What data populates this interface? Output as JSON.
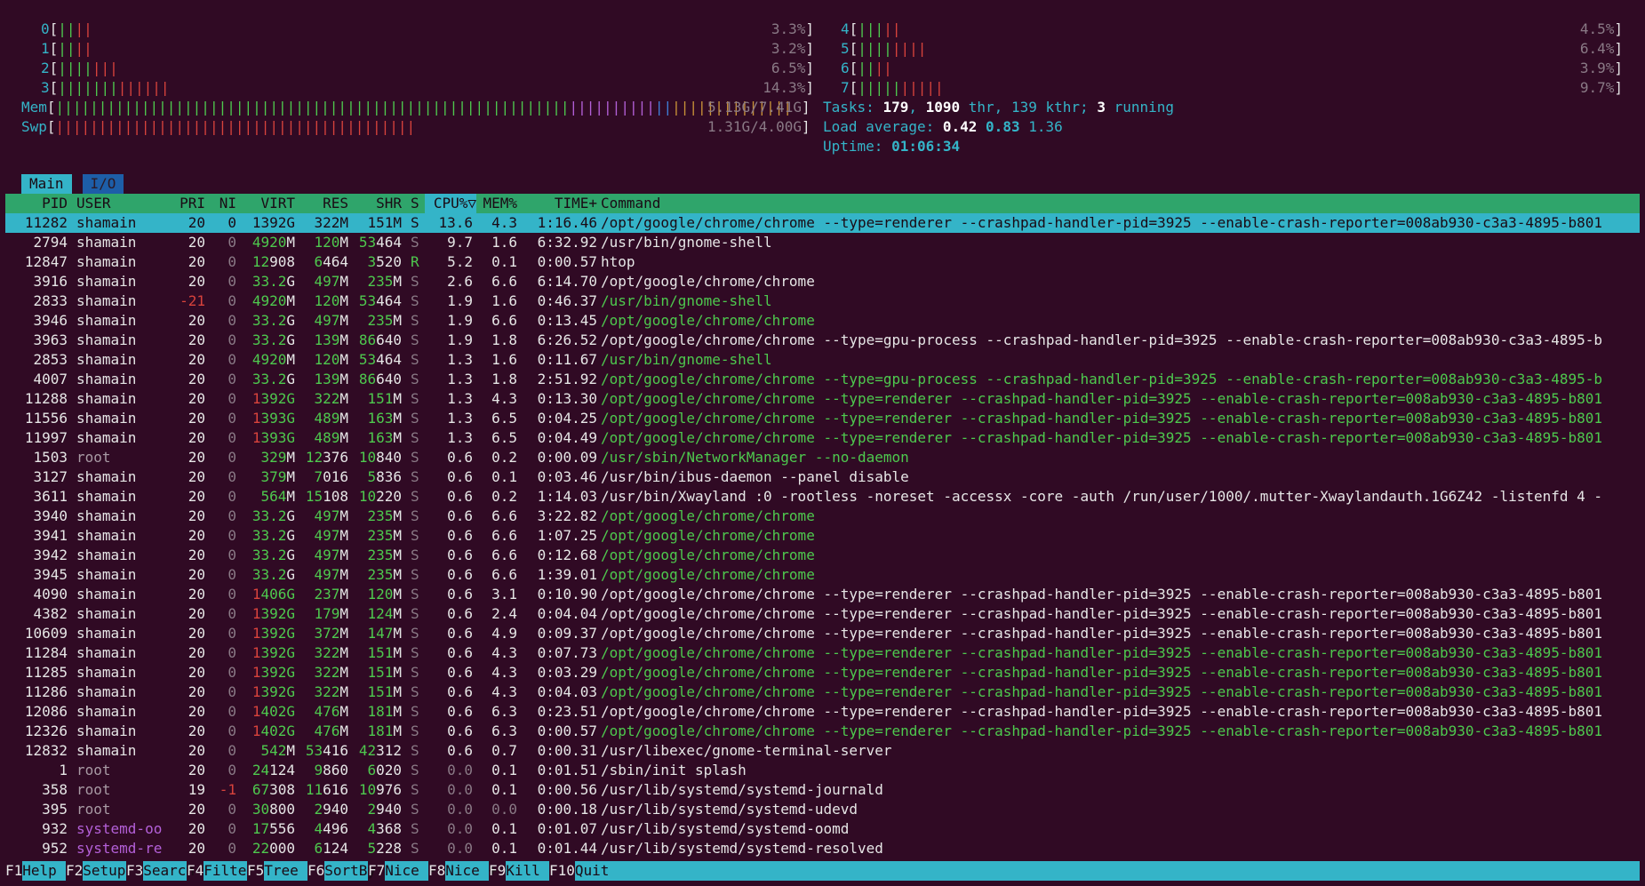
{
  "colors": {
    "background": "#300a24",
    "label": "#34b4c8",
    "green": "#4ec94e",
    "red": "#d8433c",
    "header_bg": "#2fa56b",
    "selection": "#34b4c8"
  },
  "cpus": [
    {
      "id": "0",
      "bars": "||||",
      "pct": "3.3%"
    },
    {
      "id": "1",
      "bars": "||||",
      "pct": "3.2%"
    },
    {
      "id": "2",
      "bars": "|||||||",
      "pct": "6.5%"
    },
    {
      "id": "3",
      "bars": "|||||||||||||",
      "pct": "14.3%"
    },
    {
      "id": "4",
      "bars": "|||||",
      "pct": "4.5%"
    },
    {
      "id": "5",
      "bars": "||||||||",
      "pct": "6.4%"
    },
    {
      "id": "6",
      "bars": "||||",
      "pct": "3.9%"
    },
    {
      "id": "7",
      "bars": "||||||||||",
      "pct": "9.7%"
    }
  ],
  "mem": {
    "label": "Mem",
    "used_bars": "||||||||||||||||||||||||||||||||||||||||||||||||||||||||||||",
    "buf_bars": "||||||||||",
    "cache_bars": "||||||||||||||",
    "value": "5.13G/7.41G"
  },
  "swp": {
    "label": "Swp",
    "bars": "||||||||||||||||||||||||||||||||||||||||||",
    "value": "1.31G/4.00G"
  },
  "tasks": {
    "label": "Tasks:",
    "tasks": "179",
    "thr": "1090",
    "thr_label": "thr,",
    "kthr": "139",
    "kthr_label": "kthr;",
    "running": "3",
    "running_label": "running"
  },
  "load": {
    "label": "Load average:",
    "l1": "0.42",
    "l5": "0.83",
    "l15": "1.36"
  },
  "uptime": {
    "label": "Uptime:",
    "value": "01:06:34"
  },
  "tabs": [
    "Main",
    "I/O"
  ],
  "columns": {
    "pid": "PID",
    "user": "USER",
    "pri": "PRI",
    "ni": "NI",
    "virt": "VIRT",
    "res": "RES",
    "shr": "SHR",
    "s": "S",
    "cpu": "CPU%▽",
    "mem": "MEM%",
    "time": "TIME+",
    "cmd": "Command"
  },
  "processes": [
    [
      "11282",
      "shamain",
      "20",
      "0",
      "1392G",
      "322M",
      "151M",
      "S",
      "13.6",
      "4.3",
      "1:16.46",
      "/opt/google/chrome/chrome --type=renderer --crashpad-handler-pid=3925 --enable-crash-reporter=008ab930-c3a3-4895-b801"
    ],
    [
      "2794",
      "shamain",
      "20",
      "0",
      "4920M",
      "120M",
      "53464",
      "S",
      "9.7",
      "1.6",
      "6:32.92",
      "/usr/bin/gnome-shell"
    ],
    [
      "12847",
      "shamain",
      "20",
      "0",
      "12908",
      "6464",
      "3520",
      "R",
      "5.2",
      "0.1",
      "0:00.57",
      "htop"
    ],
    [
      "3916",
      "shamain",
      "20",
      "0",
      "33.2G",
      "497M",
      "235M",
      "S",
      "2.6",
      "6.6",
      "6:14.70",
      "/opt/google/chrome/chrome"
    ],
    [
      "2833",
      "shamain",
      "-21",
      "0",
      "4920M",
      "120M",
      "53464",
      "S",
      "1.9",
      "1.6",
      "0:46.37",
      "/usr/bin/gnome-shell"
    ],
    [
      "3946",
      "shamain",
      "20",
      "0",
      "33.2G",
      "497M",
      "235M",
      "S",
      "1.9",
      "6.6",
      "0:13.45",
      "/opt/google/chrome/chrome"
    ],
    [
      "3963",
      "shamain",
      "20",
      "0",
      "33.2G",
      "139M",
      "86640",
      "S",
      "1.9",
      "1.8",
      "6:26.52",
      "/opt/google/chrome/chrome --type=gpu-process --crashpad-handler-pid=3925 --enable-crash-reporter=008ab930-c3a3-4895-b"
    ],
    [
      "2853",
      "shamain",
      "20",
      "0",
      "4920M",
      "120M",
      "53464",
      "S",
      "1.3",
      "1.6",
      "0:11.67",
      "/usr/bin/gnome-shell"
    ],
    [
      "4007",
      "shamain",
      "20",
      "0",
      "33.2G",
      "139M",
      "86640",
      "S",
      "1.3",
      "1.8",
      "2:51.92",
      "/opt/google/chrome/chrome --type=gpu-process --crashpad-handler-pid=3925 --enable-crash-reporter=008ab930-c3a3-4895-b"
    ],
    [
      "11288",
      "shamain",
      "20",
      "0",
      "1392G",
      "322M",
      "151M",
      "S",
      "1.3",
      "4.3",
      "0:13.30",
      "/opt/google/chrome/chrome --type=renderer --crashpad-handler-pid=3925 --enable-crash-reporter=008ab930-c3a3-4895-b801"
    ],
    [
      "11556",
      "shamain",
      "20",
      "0",
      "1393G",
      "489M",
      "163M",
      "S",
      "1.3",
      "6.5",
      "0:04.25",
      "/opt/google/chrome/chrome --type=renderer --crashpad-handler-pid=3925 --enable-crash-reporter=008ab930-c3a3-4895-b801"
    ],
    [
      "11997",
      "shamain",
      "20",
      "0",
      "1393G",
      "489M",
      "163M",
      "S",
      "1.3",
      "6.5",
      "0:04.49",
      "/opt/google/chrome/chrome --type=renderer --crashpad-handler-pid=3925 --enable-crash-reporter=008ab930-c3a3-4895-b801"
    ],
    [
      "1503",
      "root",
      "20",
      "0",
      "329M",
      "12376",
      "10840",
      "S",
      "0.6",
      "0.2",
      "0:00.09",
      "/usr/sbin/NetworkManager --no-daemon"
    ],
    [
      "3127",
      "shamain",
      "20",
      "0",
      "379M",
      "7016",
      "5836",
      "S",
      "0.6",
      "0.1",
      "0:03.46",
      "/usr/bin/ibus-daemon --panel disable"
    ],
    [
      "3611",
      "shamain",
      "20",
      "0",
      "564M",
      "15108",
      "10220",
      "S",
      "0.6",
      "0.2",
      "1:14.03",
      "/usr/bin/Xwayland :0 -rootless -noreset -accessx -core -auth /run/user/1000/.mutter-Xwaylandauth.1G6Z42 -listenfd 4 -"
    ],
    [
      "3940",
      "shamain",
      "20",
      "0",
      "33.2G",
      "497M",
      "235M",
      "S",
      "0.6",
      "6.6",
      "3:22.82",
      "/opt/google/chrome/chrome"
    ],
    [
      "3941",
      "shamain",
      "20",
      "0",
      "33.2G",
      "497M",
      "235M",
      "S",
      "0.6",
      "6.6",
      "1:07.25",
      "/opt/google/chrome/chrome"
    ],
    [
      "3942",
      "shamain",
      "20",
      "0",
      "33.2G",
      "497M",
      "235M",
      "S",
      "0.6",
      "6.6",
      "0:12.68",
      "/opt/google/chrome/chrome"
    ],
    [
      "3945",
      "shamain",
      "20",
      "0",
      "33.2G",
      "497M",
      "235M",
      "S",
      "0.6",
      "6.6",
      "1:39.01",
      "/opt/google/chrome/chrome"
    ],
    [
      "4090",
      "shamain",
      "20",
      "0",
      "1406G",
      "237M",
      "120M",
      "S",
      "0.6",
      "3.1",
      "0:10.90",
      "/opt/google/chrome/chrome --type=renderer --crashpad-handler-pid=3925 --enable-crash-reporter=008ab930-c3a3-4895-b801"
    ],
    [
      "4382",
      "shamain",
      "20",
      "0",
      "1392G",
      "179M",
      "124M",
      "S",
      "0.6",
      "2.4",
      "0:04.04",
      "/opt/google/chrome/chrome --type=renderer --crashpad-handler-pid=3925 --enable-crash-reporter=008ab930-c3a3-4895-b801"
    ],
    [
      "10609",
      "shamain",
      "20",
      "0",
      "1392G",
      "372M",
      "147M",
      "S",
      "0.6",
      "4.9",
      "0:09.37",
      "/opt/google/chrome/chrome --type=renderer --crashpad-handler-pid=3925 --enable-crash-reporter=008ab930-c3a3-4895-b801"
    ],
    [
      "11284",
      "shamain",
      "20",
      "0",
      "1392G",
      "322M",
      "151M",
      "S",
      "0.6",
      "4.3",
      "0:07.73",
      "/opt/google/chrome/chrome --type=renderer --crashpad-handler-pid=3925 --enable-crash-reporter=008ab930-c3a3-4895-b801"
    ],
    [
      "11285",
      "shamain",
      "20",
      "0",
      "1392G",
      "322M",
      "151M",
      "S",
      "0.6",
      "4.3",
      "0:03.29",
      "/opt/google/chrome/chrome --type=renderer --crashpad-handler-pid=3925 --enable-crash-reporter=008ab930-c3a3-4895-b801"
    ],
    [
      "11286",
      "shamain",
      "20",
      "0",
      "1392G",
      "322M",
      "151M",
      "S",
      "0.6",
      "4.3",
      "0:04.03",
      "/opt/google/chrome/chrome --type=renderer --crashpad-handler-pid=3925 --enable-crash-reporter=008ab930-c3a3-4895-b801"
    ],
    [
      "12086",
      "shamain",
      "20",
      "0",
      "1402G",
      "476M",
      "181M",
      "S",
      "0.6",
      "6.3",
      "0:23.51",
      "/opt/google/chrome/chrome --type=renderer --crashpad-handler-pid=3925 --enable-crash-reporter=008ab930-c3a3-4895-b801"
    ],
    [
      "12326",
      "shamain",
      "20",
      "0",
      "1402G",
      "476M",
      "181M",
      "S",
      "0.6",
      "6.3",
      "0:00.57",
      "/opt/google/chrome/chrome --type=renderer --crashpad-handler-pid=3925 --enable-crash-reporter=008ab930-c3a3-4895-b801"
    ],
    [
      "12832",
      "shamain",
      "20",
      "0",
      "542M",
      "53416",
      "42312",
      "S",
      "0.6",
      "0.7",
      "0:00.31",
      "/usr/libexec/gnome-terminal-server"
    ],
    [
      "1",
      "root",
      "20",
      "0",
      "24124",
      "9860",
      "6020",
      "S",
      "0.0",
      "0.1",
      "0:01.51",
      "/sbin/init splash"
    ],
    [
      "358",
      "root",
      "19",
      "-1",
      "67308",
      "11616",
      "10976",
      "S",
      "0.0",
      "0.1",
      "0:00.56",
      "/usr/lib/systemd/systemd-journald"
    ],
    [
      "395",
      "root",
      "20",
      "0",
      "30800",
      "2940",
      "2940",
      "S",
      "0.0",
      "0.0",
      "0:00.18",
      "/usr/lib/systemd/systemd-udevd"
    ],
    [
      "932",
      "systemd-oo",
      "20",
      "0",
      "17556",
      "4496",
      "4368",
      "S",
      "0.0",
      "0.1",
      "0:01.07",
      "/usr/lib/systemd/systemd-oomd"
    ],
    [
      "952",
      "systemd-re",
      "20",
      "0",
      "22000",
      "6124",
      "5228",
      "S",
      "0.0",
      "0.1",
      "0:01.44",
      "/usr/lib/systemd/systemd-resolved"
    ]
  ],
  "threads_highlighted": [
    "2833",
    "3946",
    "2853",
    "4007",
    "11288",
    "11556",
    "11997",
    "1503",
    "3940",
    "3941",
    "3942",
    "3945",
    "11284",
    "11285",
    "11286",
    "12326"
  ],
  "fkeys": [
    {
      "k": "F1",
      "l": "Help"
    },
    {
      "k": "F2",
      "l": "Setup"
    },
    {
      "k": "F3",
      "l": "Search"
    },
    {
      "k": "F4",
      "l": "Filter"
    },
    {
      "k": "F5",
      "l": "Tree"
    },
    {
      "k": "F6",
      "l": "SortBy"
    },
    {
      "k": "F7",
      "l": "Nice -"
    },
    {
      "k": "F8",
      "l": "Nice +"
    },
    {
      "k": "F9",
      "l": "Kill"
    },
    {
      "k": "F10",
      "l": "Quit"
    }
  ]
}
